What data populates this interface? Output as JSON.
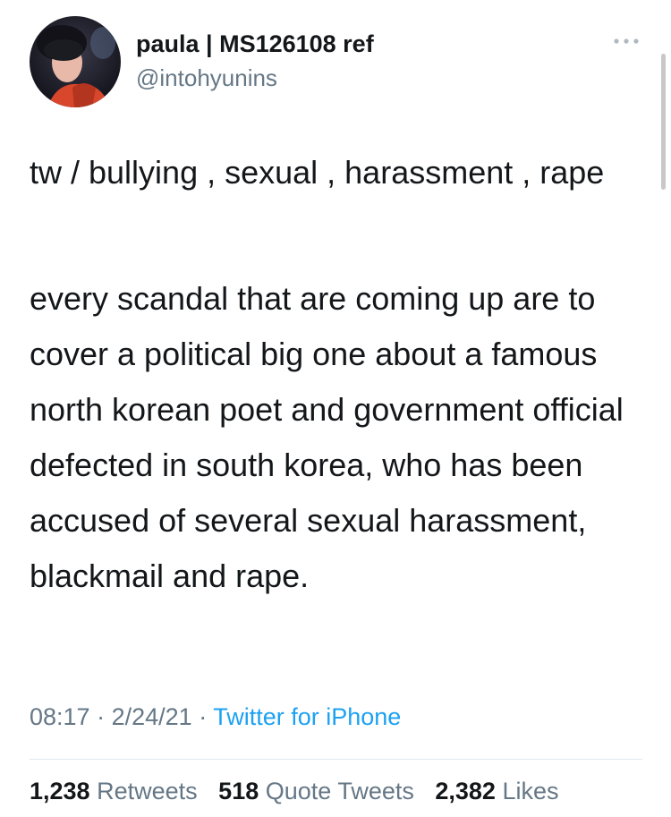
{
  "user": {
    "display_name": "paula | MS126108 ref",
    "handle": "@intohyunins"
  },
  "tweet": {
    "content_warning": "tw / bullying , sexual , harassment , rape",
    "text": "every scandal that are coming up are to cover a political big one about a famous north korean poet and government official defected in south korea, who has been accused of several sexual harassment, blackmail and rape.",
    "time": "08:17",
    "separator": "·",
    "date": "2/24/21",
    "source": "Twitter for iPhone"
  },
  "stats": {
    "retweets_count": "1,238",
    "retweets_label": "Retweets",
    "quote_tweets_count": "518",
    "quote_tweets_label": "Quote Tweets",
    "likes_count": "2,382",
    "likes_label": "Likes"
  },
  "icons": {
    "avatar": "avatar-photo",
    "more": "more-options-icon"
  },
  "colors": {
    "text": "#14171a",
    "secondary": "#657786",
    "link": "#1da1f2",
    "divider": "#e1e8ed"
  }
}
